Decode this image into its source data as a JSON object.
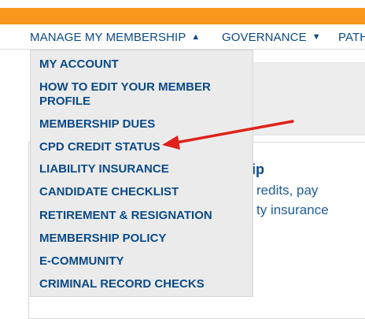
{
  "nav": {
    "items": [
      {
        "label": "MANAGE MY MEMBERSHIP",
        "caret": "▲"
      },
      {
        "label": "GOVERNANCE",
        "caret": "▼"
      },
      {
        "label": "PATH",
        "caret": ""
      }
    ]
  },
  "dropdown": {
    "items": [
      {
        "label": "MY ACCOUNT"
      },
      {
        "label": "HOW TO EDIT YOUR MEMBER PROFILE"
      },
      {
        "label": "MEMBERSHIP DUES"
      },
      {
        "label": "CPD CREDIT STATUS"
      },
      {
        "label": "LIABILITY INSURANCE"
      },
      {
        "label": "CANDIDATE CHECKLIST"
      },
      {
        "label": "RETIREMENT & RESIGNATION"
      },
      {
        "label": "MEMBERSHIP POLICY"
      },
      {
        "label": "E-COMMUNITY"
      },
      {
        "label": "CRIMINAL RECORD CHECKS"
      }
    ]
  },
  "card": {
    "title": "hip",
    "line1": "redits, pay",
    "line2": "ty insurance"
  },
  "colors": {
    "accent": "#f7981c",
    "link": "#0b4a86",
    "arrow": "#e0201b"
  }
}
